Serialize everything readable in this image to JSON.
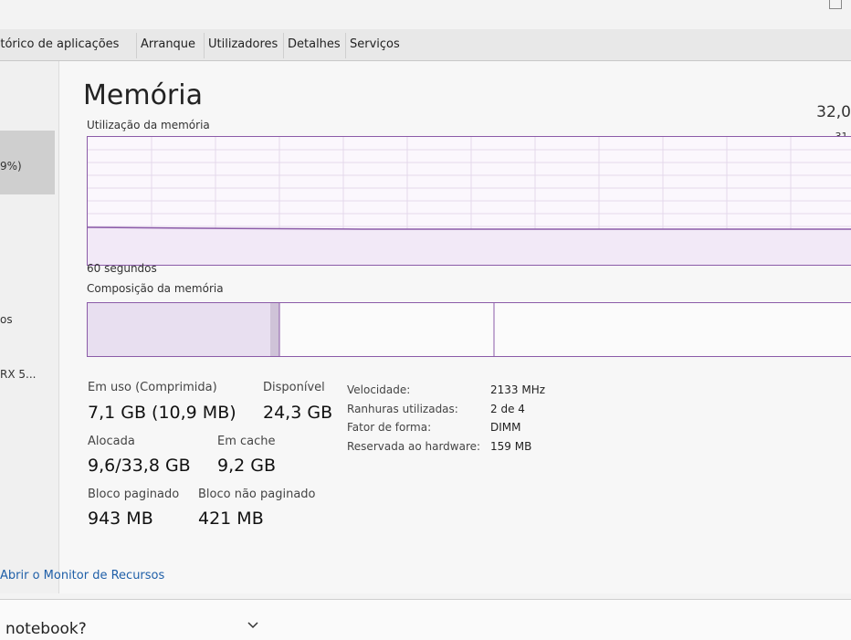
{
  "tabs": [
    "istórico de aplicações",
    "Arranque",
    "Utilizadores",
    "Detalhes",
    "Serviços"
  ],
  "sidebar": {
    "items": [
      "9%)",
      "os",
      "RX 5..."
    ]
  },
  "panel": {
    "title": "Memória",
    "total": "32,0",
    "usage_label": "Utilização da memória",
    "graph_max": "31,",
    "time_label": "60 segundos",
    "composition_label": "Composição da memória"
  },
  "stats": {
    "in_use_label": "Em uso (Comprimida)",
    "in_use_value": "7,1 GB (10,9 MB)",
    "available_label": "Disponível",
    "available_value": "24,3 GB",
    "committed_label": "Alocada",
    "committed_value": "9,6/33,8 GB",
    "cached_label": "Em cache",
    "cached_value": "9,2 GB",
    "paged_label": "Bloco paginado",
    "paged_value": "943 MB",
    "nonpaged_label": "Bloco não paginado",
    "nonpaged_value": "421 MB"
  },
  "properties": [
    {
      "key": "Velocidade:",
      "value": "2133 MHz"
    },
    {
      "key": "Ranhuras utilizadas:",
      "value": "2 de 4"
    },
    {
      "key": "Fator de forma:",
      "value": "DIMM"
    },
    {
      "key": "Reservada ao hardware:",
      "value": "159 MB"
    }
  ],
  "footer": {
    "resource_monitor_link": "Abrir o Monitor de Recursos"
  },
  "bottom": {
    "text": "notebook?"
  },
  "colors": {
    "graph_border": "#8b5ba8",
    "link": "#1f5fa8"
  },
  "icons": [
    "chevron-down-icon",
    "maximize-icon"
  ]
}
